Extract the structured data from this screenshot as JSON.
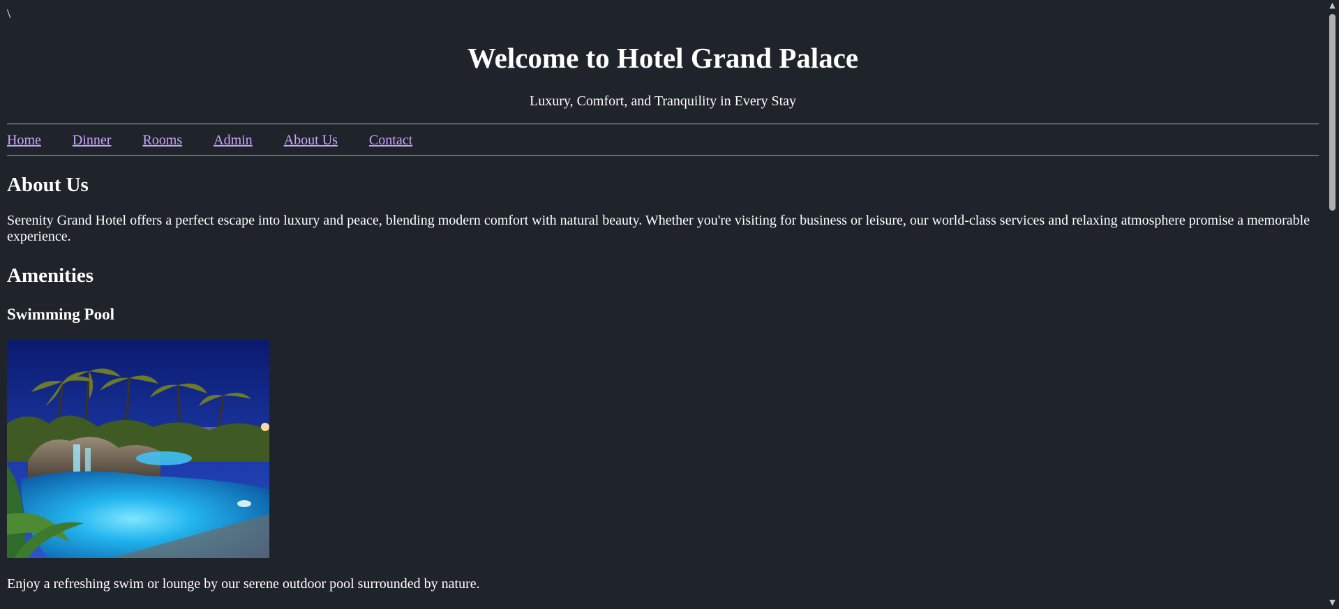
{
  "stray_text": "\\",
  "header": {
    "title": "Welcome to Hotel Grand Palace",
    "tagline": "Luxury, Comfort, and Tranquility in Every Stay"
  },
  "nav": {
    "items": [
      {
        "label": "Home"
      },
      {
        "label": "Dinner"
      },
      {
        "label": "Rooms"
      },
      {
        "label": "Admin"
      },
      {
        "label": "About Us"
      },
      {
        "label": "Contact"
      }
    ]
  },
  "about": {
    "heading": "About Us",
    "text": "Serenity Grand Hotel offers a perfect escape into luxury and peace, blending modern comfort with natural beauty. Whether you're visiting for business or leisure, our world-class services and relaxing atmosphere promise a memorable experience."
  },
  "amenities": {
    "heading": "Amenities",
    "items": [
      {
        "title": "Swimming Pool",
        "caption": "Enjoy a refreshing swim or lounge by our serene outdoor pool surrounded by nature."
      }
    ]
  },
  "colors": {
    "background": "#1f232a",
    "text": "#ffffff",
    "link": "#c9a3ff"
  },
  "icons": {
    "scroll_up": "scroll-up-arrow-icon",
    "scroll_down": "scroll-down-arrow-icon"
  }
}
